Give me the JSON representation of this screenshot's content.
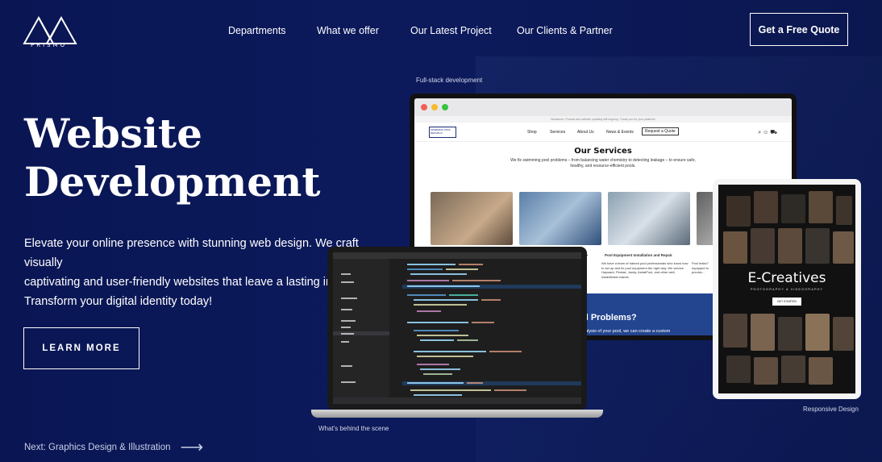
{
  "brand": {
    "name": "PRISMO"
  },
  "nav": {
    "items": [
      "Departments",
      "What we offer",
      "Our Latest Project",
      "Our Clients & Partner"
    ],
    "cta": "Get a Free Quote"
  },
  "hero": {
    "title_line1": "Website",
    "title_line2": "Development",
    "description_line1": "Elevate your online presence with stunning web design. We craft visually",
    "description_line2": "captivating and user-friendly websites that leave a lasting impre",
    "description_line3": "Transform your digital identity today!",
    "learn_more": "LEARN MORE",
    "next": "Next: Graphics Design & Illustration"
  },
  "captions": {
    "fullstack": "Full-stack development",
    "behind": "What's behind the scene",
    "responsive": "Responsive Design"
  },
  "mock_site": {
    "announce": "Disclaimer: Product and website updating still ongoing. Thank you for your patience!",
    "logo": "SWIMMING POOL REPUBLIC",
    "nav": [
      "Shop",
      "Services",
      "About Us",
      "News & Events"
    ],
    "request": "Request a Quote",
    "services_title": "Our Services",
    "services_sub": "We fix swimming pool problems – from balancing water chemistry to detecting leakage – to ensure safe, healthy, and resource-efficient pools.",
    "card3_title": "Pool Equipment Installation and Repair",
    "card3_text": "We have a team of trained pool professionals who know how to set up and fix pool equipment the right way. We service Hayward, Pentair, Jandy, AstralPool, and other well-established brands.",
    "card2_title": "ce",
    "card4_text": "Pool leaks? equipped to precise...",
    "band_title": "ol Problems?",
    "band_sub": "analysis of your pool, we can create a custom"
  },
  "tablet_site": {
    "title": "E-Creatives",
    "subtitle": "PHOTOGRAPHY & VIDEOGRAPHY",
    "button": "GET STARTED"
  },
  "colors": {
    "background": "#0a1654",
    "accent_band": "#23458f"
  }
}
